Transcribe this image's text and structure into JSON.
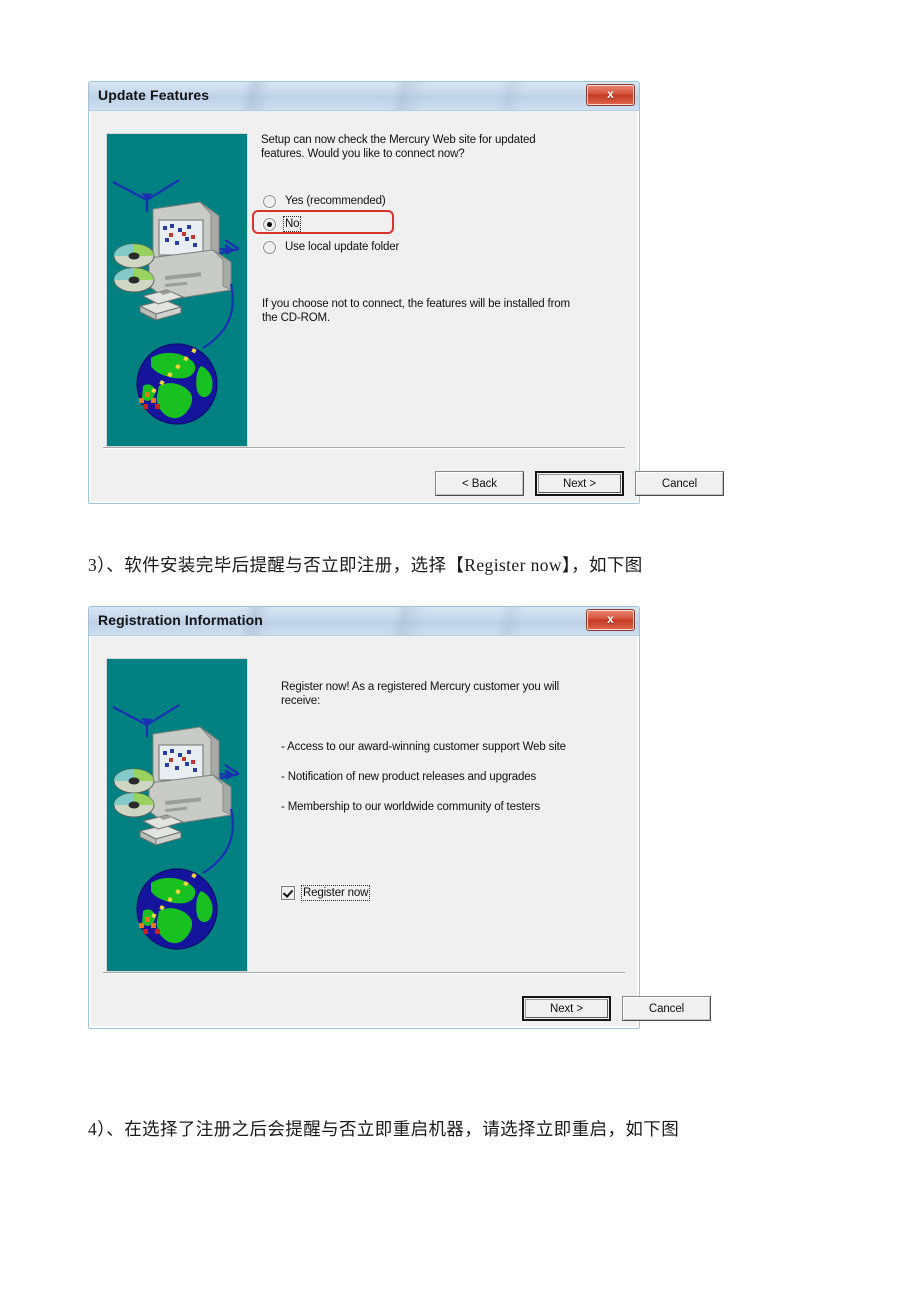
{
  "page": {
    "background": "#ffffff",
    "paragraphs": [
      {
        "id": "step3",
        "text": "3）、软件安装完毕后提醒与否立即注册，选择【Register now】，如下图"
      },
      {
        "id": "step4",
        "text": "4）、在选择了注册之后会提醒与否立即重启机器，请选择立即重启，如下图"
      }
    ]
  },
  "colors": {
    "titlebar_start": "#d8e6f4",
    "titlebar_end": "#cddff0",
    "dialog_face": "#f0f0f0",
    "illustration_background": "#008080",
    "close_button": "#c33a22",
    "highlight_red": "#d6342c",
    "globe_green": "#18c020",
    "globe_blue": "#1414a8",
    "arrow_blue": "#1a2fb4"
  },
  "dialog1": {
    "title": "Update Features",
    "close_label": "x",
    "intro_line1": "Setup can now check the Mercury Web site for updated",
    "intro_line2": "features. Would you like to connect now?",
    "options": [
      {
        "label": "Yes (recommended)",
        "accel": "Y",
        "selected": false
      },
      {
        "label": "No",
        "accel": "N",
        "selected": true
      },
      {
        "label": "Use local update folder",
        "accel": "U",
        "selected": false
      }
    ],
    "note_line1": "If you choose not to connect, the features will be installed from",
    "note_line2": "the CD-ROM.",
    "buttons": [
      {
        "label": "< Back",
        "accel": "B",
        "default": false
      },
      {
        "label": "Next >",
        "accel": "N",
        "default": true
      },
      {
        "label": "Cancel",
        "accel": "",
        "default": false
      }
    ],
    "highlight_target": "No"
  },
  "dialog2": {
    "title": "Registration Information",
    "close_label": "x",
    "intro_line1": "Register now! As a registered Mercury customer you will",
    "intro_line2": "receive:",
    "bullets": [
      "- Access to our award-winning customer support Web site",
      "- Notification of new product releases and upgrades",
      "- Membership to our worldwide community of testers"
    ],
    "checkbox": {
      "label": "Register now",
      "accel": "R",
      "checked": true
    },
    "buttons": [
      {
        "label": "Next >",
        "accel": "N",
        "default": true
      },
      {
        "label": "Cancel",
        "accel": "",
        "default": false
      }
    ]
  },
  "illustration": {
    "name": "setup-computer-globe-illustration",
    "elements": [
      "network-arrows",
      "crt-monitor",
      "computer-tower",
      "cd-discs",
      "floppy-disks",
      "world-globe"
    ]
  }
}
